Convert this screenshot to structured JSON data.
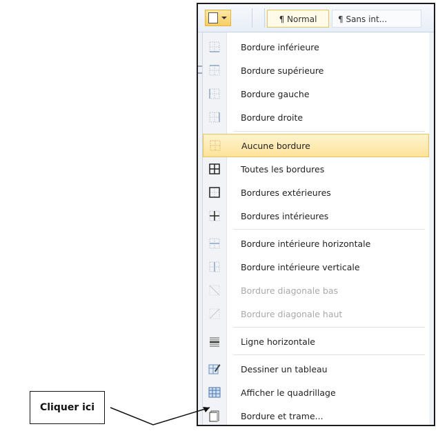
{
  "toolbar": {
    "style_normal": "¶ Normal",
    "style_sans": "¶ Sans int...",
    "style_cut": "1"
  },
  "menu": {
    "items": [
      {
        "label": "Bordure inférieure",
        "icon": "border-bottom-icon",
        "enabled": true
      },
      {
        "label": "Bordure supérieure",
        "icon": "border-top-icon",
        "enabled": true
      },
      {
        "label": "Bordure gauche",
        "icon": "border-left-icon",
        "enabled": true
      },
      {
        "label": "Bordure droite",
        "icon": "border-right-icon",
        "enabled": true
      },
      {
        "label": "Aucune bordure",
        "icon": "no-border-icon",
        "enabled": true,
        "highlighted": true
      },
      {
        "label": "Toutes les bordures",
        "icon": "all-borders-icon",
        "enabled": true
      },
      {
        "label": "Bordures extérieures",
        "icon": "outside-borders-icon",
        "enabled": true
      },
      {
        "label": "Bordures intérieures",
        "icon": "inside-borders-icon",
        "enabled": true
      },
      {
        "label": "Bordure intérieure horizontale",
        "icon": "inside-horizontal-border-icon",
        "enabled": true
      },
      {
        "label": "Bordure intérieure verticale",
        "icon": "inside-vertical-border-icon",
        "enabled": true
      },
      {
        "label": "Bordure diagonale bas",
        "icon": "diagonal-down-border-icon",
        "enabled": false
      },
      {
        "label": "Bordure diagonale haut",
        "icon": "diagonal-up-border-icon",
        "enabled": false
      },
      {
        "label": "Ligne horizontale",
        "icon": "horizontal-line-icon",
        "enabled": true
      },
      {
        "label": "Dessiner un tableau",
        "icon": "draw-table-icon",
        "enabled": true
      },
      {
        "label": "Afficher le quadrillage",
        "icon": "view-gridlines-icon",
        "enabled": true
      },
      {
        "label": "Bordure et trame...",
        "icon": "borders-shading-icon",
        "enabled": true
      }
    ]
  },
  "annotation": {
    "text": "Cliquer ici"
  },
  "colors": {
    "highlight": "#fde39a",
    "highlight_border": "#e8c25a",
    "disabled_text": "#a9a9a9"
  }
}
